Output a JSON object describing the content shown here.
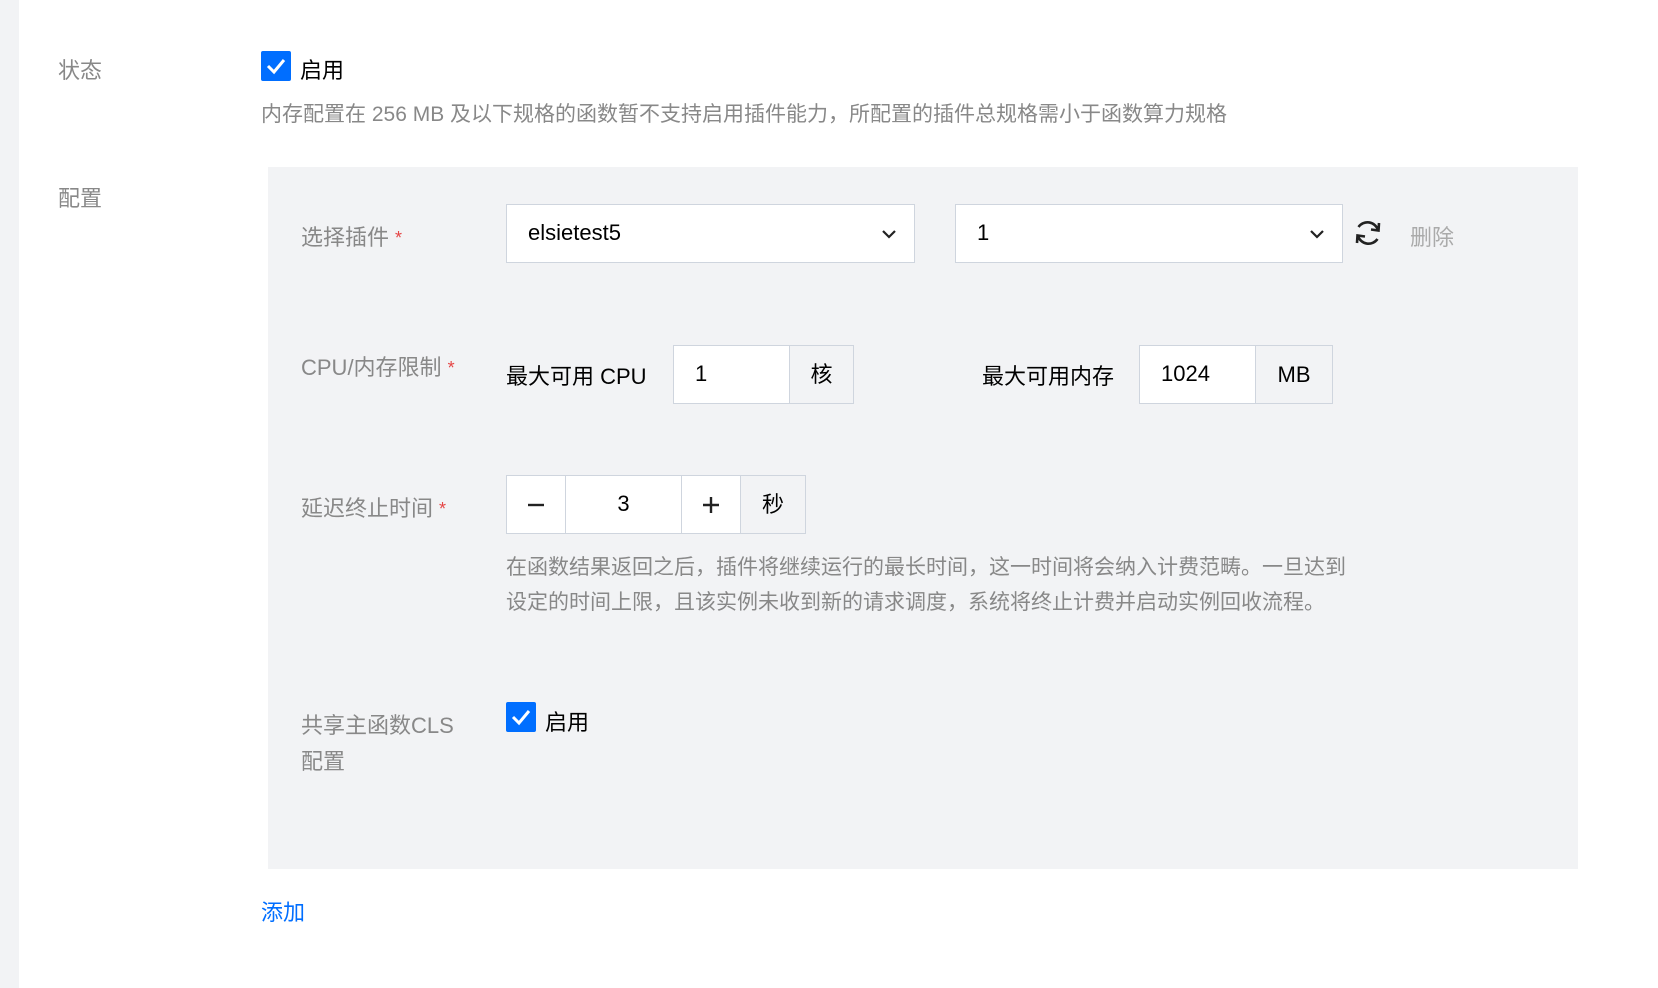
{
  "status": {
    "label": "状态",
    "enable_label": "启用",
    "enabled": true,
    "hint": "内存配置在 256 MB 及以下规格的函数暂不支持启用插件能力，所配置的插件总规格需小于函数算力规格"
  },
  "config": {
    "label": "配置",
    "plugin": {
      "label": "选择插件",
      "required_mark": "*",
      "name_value": "elsietest5",
      "version_value": "1",
      "delete_label": "删除"
    },
    "limits": {
      "label": "CPU/内存限制",
      "required_mark": "*",
      "cpu_label": "最大可用 CPU",
      "cpu_value": "1",
      "cpu_unit": "核",
      "mem_label": "最大可用内存",
      "mem_value": "1024",
      "mem_unit": "MB"
    },
    "delay": {
      "label": "延迟终止时间",
      "required_mark": "*",
      "minus": "−",
      "value": "3",
      "plus": "+",
      "unit": "秒",
      "hint_line1": "在函数结果返回之后，插件将继续运行的最长时间，这一时间将会纳入计费范畴。一旦达到",
      "hint_line2": "设定的时间上限，且该实例未收到新的请求调度，系统将终止计费并启动实例回收流程。"
    },
    "cls": {
      "label_line1": "共享主函数CLS",
      "label_line2": "配置",
      "enable_label": "启用",
      "enabled": true
    }
  },
  "add_label": "添加",
  "colors": {
    "primary": "#006eff",
    "required": "#e54545",
    "panel_bg": "#f2f3f5",
    "muted_text": "#888888"
  },
  "icons": [
    "check-icon",
    "chevron-down-icon",
    "refresh-icon"
  ]
}
